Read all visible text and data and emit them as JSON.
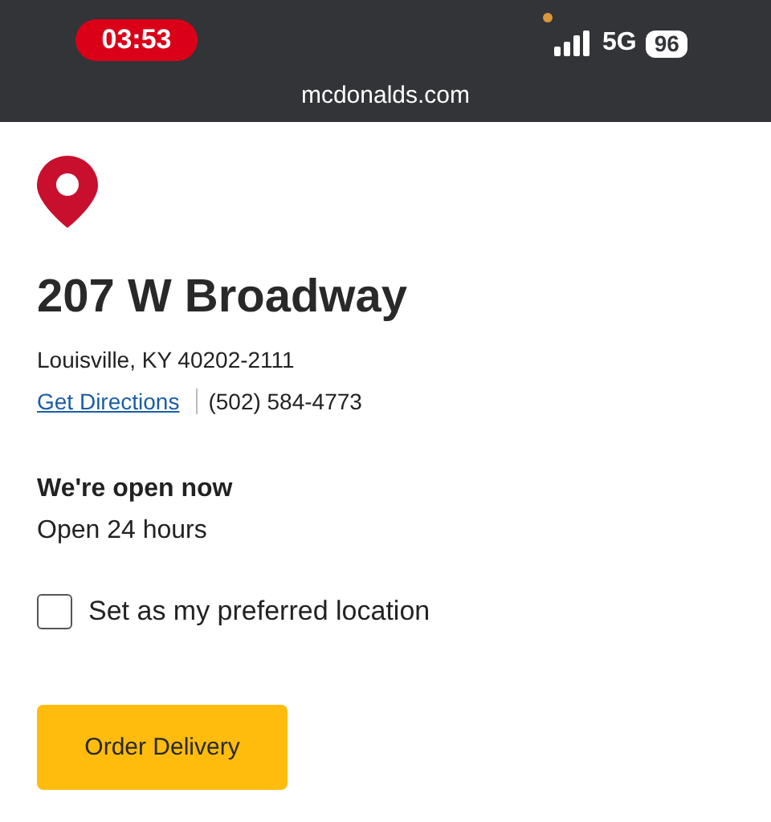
{
  "status_bar": {
    "time": "03:53",
    "network": "5G",
    "battery": "96"
  },
  "address_bar": {
    "url": "mcdonalds.com"
  },
  "restaurant": {
    "name": "207 W Broadway",
    "address": "Louisville, KY 40202-2111",
    "directions_link": "Get Directions",
    "phone": "(502) 584-4773"
  },
  "hours": {
    "status": "We're open now",
    "detail": "Open 24 hours"
  },
  "preferred": {
    "label": "Set as my preferred location",
    "checked": false
  },
  "buttons": [
    "Order Delivery"
  ]
}
